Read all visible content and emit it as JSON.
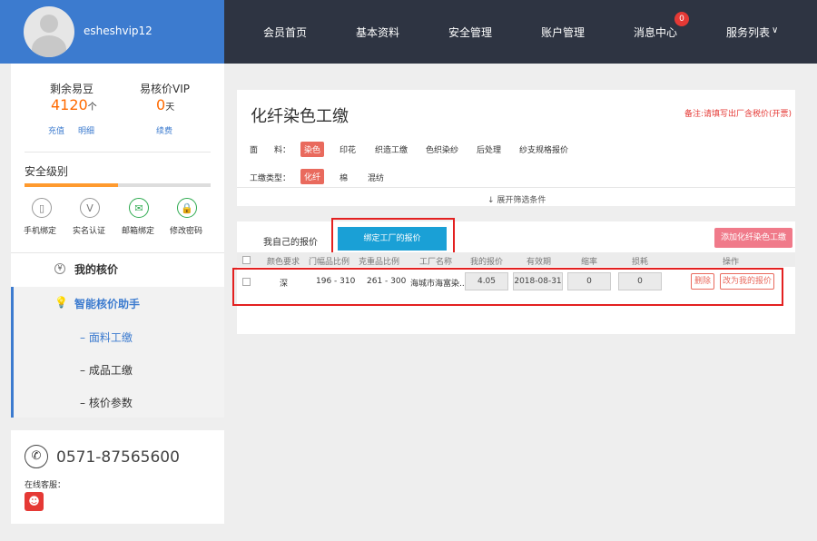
{
  "user": {
    "name": "esheshvip12"
  },
  "nav": {
    "items": [
      "会员首页",
      "基本资料",
      "安全管理",
      "账户管理",
      "消息中心",
      "服务列表"
    ],
    "chevron": "∨",
    "message_badge": "0"
  },
  "stats": {
    "beans_label": "剩余易豆",
    "beans_value": "4120",
    "beans_unit": "个",
    "recharge": "充值",
    "detail": "明细",
    "vip_label": "易核价VIP",
    "vip_value": "0",
    "vip_unit": "天",
    "renew": "续费"
  },
  "security": {
    "label": "安全级别",
    "level": 0.5,
    "items": [
      {
        "label": "手机绑定",
        "icon": "phone-icon"
      },
      {
        "label": "实名认证",
        "icon": "verify-icon"
      },
      {
        "label": "邮箱绑定",
        "icon": "mail-icon"
      },
      {
        "label": "修改密码",
        "icon": "lock-icon"
      }
    ]
  },
  "sidebar": {
    "my_price": "我的核价",
    "assistant": "智能核价助手",
    "sub": [
      "面料工缴",
      "成品工缴",
      "核价参数"
    ]
  },
  "contact": {
    "phone": "0571-87565600",
    "online": "在线客服："
  },
  "page": {
    "title": "化纤染色工缴",
    "notice": "备注:请填写出厂含税价(开票)",
    "filter_label_1": "面　　料：",
    "fabric_tags": [
      "染色",
      "印花",
      "织造工缴",
      "色织染纱",
      "后处理",
      "纱支规格报价"
    ],
    "filter_label_2": "工缴类型：",
    "type_tags": [
      "化纤",
      "棉",
      "混纺"
    ],
    "expand": "↓ 展开筛选条件"
  },
  "tabs": {
    "mine": "我自己的报价",
    "factory": "绑定工厂的报价",
    "add": "添加化纤染色工缴"
  },
  "table": {
    "headers": [
      "颜色要求",
      "门幅品比例",
      "克重品比例",
      "工厂名称",
      "我的报价",
      "有效期",
      "缩率",
      "损耗",
      "操作"
    ],
    "row": {
      "color": "深",
      "width": "196 - 310",
      "weight": "261 - 300",
      "factory": "海城市海富染..",
      "price": "4.05",
      "expiry": "2018-08-31",
      "shrink": "0",
      "loss": "0",
      "delete": "删除",
      "change": "改为我的报价"
    }
  },
  "colors": {
    "nav_bg": "#2e3442",
    "user_bg": "#3c7bcf",
    "accent_orange": "#ff6a00",
    "tag_red": "#e96a5d",
    "tab_blue": "#1aa0d6",
    "highlight_red": "#e32020"
  }
}
